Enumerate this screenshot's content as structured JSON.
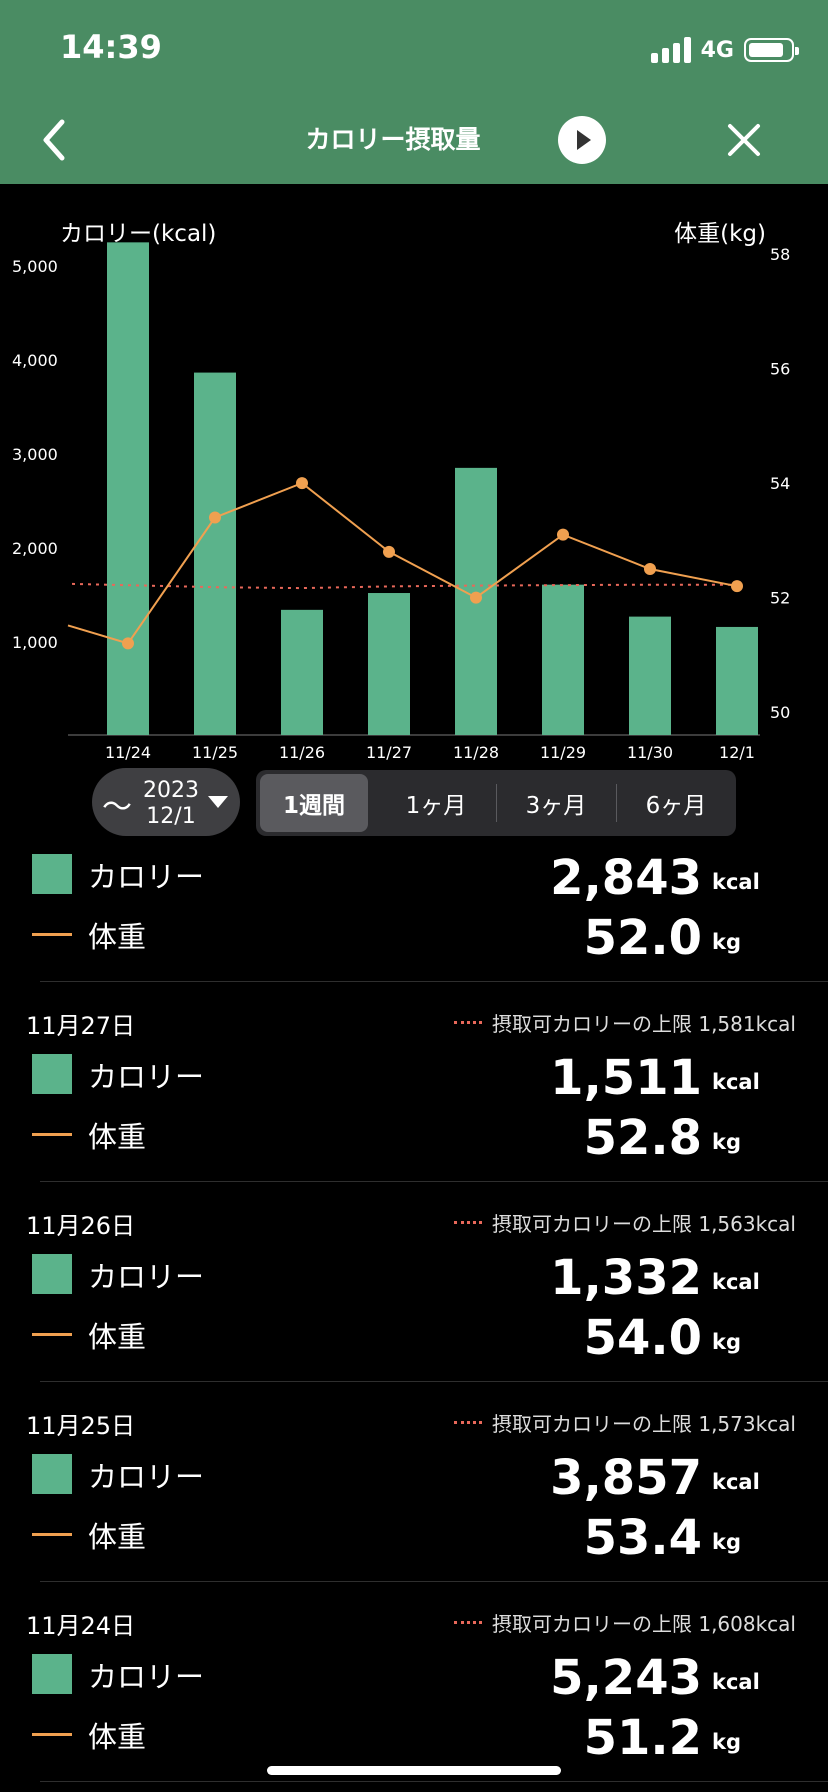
{
  "status_bar": {
    "time": "14:39",
    "network": "4G"
  },
  "header": {
    "title": "カロリー摂取量"
  },
  "chart": {
    "left_axis_label": "カロリー(kcal)",
    "right_axis_label": "体重(kg)"
  },
  "chart_data": {
    "type": "bar",
    "categories": [
      "11/24",
      "11/25",
      "11/26",
      "11/27",
      "11/28",
      "11/29",
      "11/30",
      "12/1"
    ],
    "series": [
      {
        "name": "カロリー",
        "type": "bar",
        "axis": "left",
        "color": "#5bb38b",
        "values": [
          5243,
          3857,
          1332,
          1511,
          2843,
          1600,
          1260,
          1150
        ]
      },
      {
        "name": "体重",
        "type": "line",
        "axis": "right",
        "color": "#f0a050",
        "values": [
          51.2,
          53.4,
          54.0,
          52.8,
          52.0,
          53.1,
          52.5,
          52.2
        ]
      },
      {
        "name": "摂取可カロリーの上限",
        "type": "line",
        "style": "dotted",
        "axis": "left",
        "color": "#e8685a",
        "values": [
          1608,
          1573,
          1563,
          1581,
          1590,
          1595,
          1600,
          1600
        ]
      }
    ],
    "left_axis": {
      "ticks": [
        "1,000",
        "2,000",
        "3,000",
        "4,000",
        "5,000"
      ],
      "tick_values": [
        1000,
        2000,
        3000,
        4000,
        5000
      ],
      "range": [
        0,
        5300
      ]
    },
    "right_axis": {
      "ticks": [
        "50",
        "52",
        "54",
        "56",
        "58"
      ],
      "tick_values": [
        50,
        52,
        54,
        56,
        58
      ],
      "range": [
        49.6,
        58.3
      ]
    },
    "grid": false,
    "legend": "none"
  },
  "controls": {
    "date_picker": {
      "tilde": "〜",
      "year": "2023",
      "date": "12/1"
    },
    "periods": [
      "1週間",
      "1ヶ月",
      "3ヶ月",
      "6ヶ月"
    ],
    "active_period": "1週間"
  },
  "summary": {
    "calorie_label": "カロリー",
    "calorie_value": "2,843",
    "calorie_unit": "kcal",
    "weight_label": "体重",
    "weight_value": "52.0",
    "weight_unit": "kg"
  },
  "entries": [
    {
      "date": "11月27日",
      "limit_text": "摂取可カロリーの上限 1,581kcal",
      "calorie_label": "カロリー",
      "calorie_value": "1,511",
      "calorie_unit": "kcal",
      "weight_label": "体重",
      "weight_value": "52.8",
      "weight_unit": "kg"
    },
    {
      "date": "11月26日",
      "limit_text": "摂取可カロリーの上限 1,563kcal",
      "calorie_label": "カロリー",
      "calorie_value": "1,332",
      "calorie_unit": "kcal",
      "weight_label": "体重",
      "weight_value": "54.0",
      "weight_unit": "kg"
    },
    {
      "date": "11月25日",
      "limit_text": "摂取可カロリーの上限 1,573kcal",
      "calorie_label": "カロリー",
      "calorie_value": "3,857",
      "calorie_unit": "kcal",
      "weight_label": "体重",
      "weight_value": "53.4",
      "weight_unit": "kg"
    },
    {
      "date": "11月24日",
      "limit_text": "摂取可カロリーの上限 1,608kcal",
      "calorie_label": "カロリー",
      "calorie_value": "5,243",
      "calorie_unit": "kcal",
      "weight_label": "体重",
      "weight_value": "51.2",
      "weight_unit": "kg"
    }
  ]
}
